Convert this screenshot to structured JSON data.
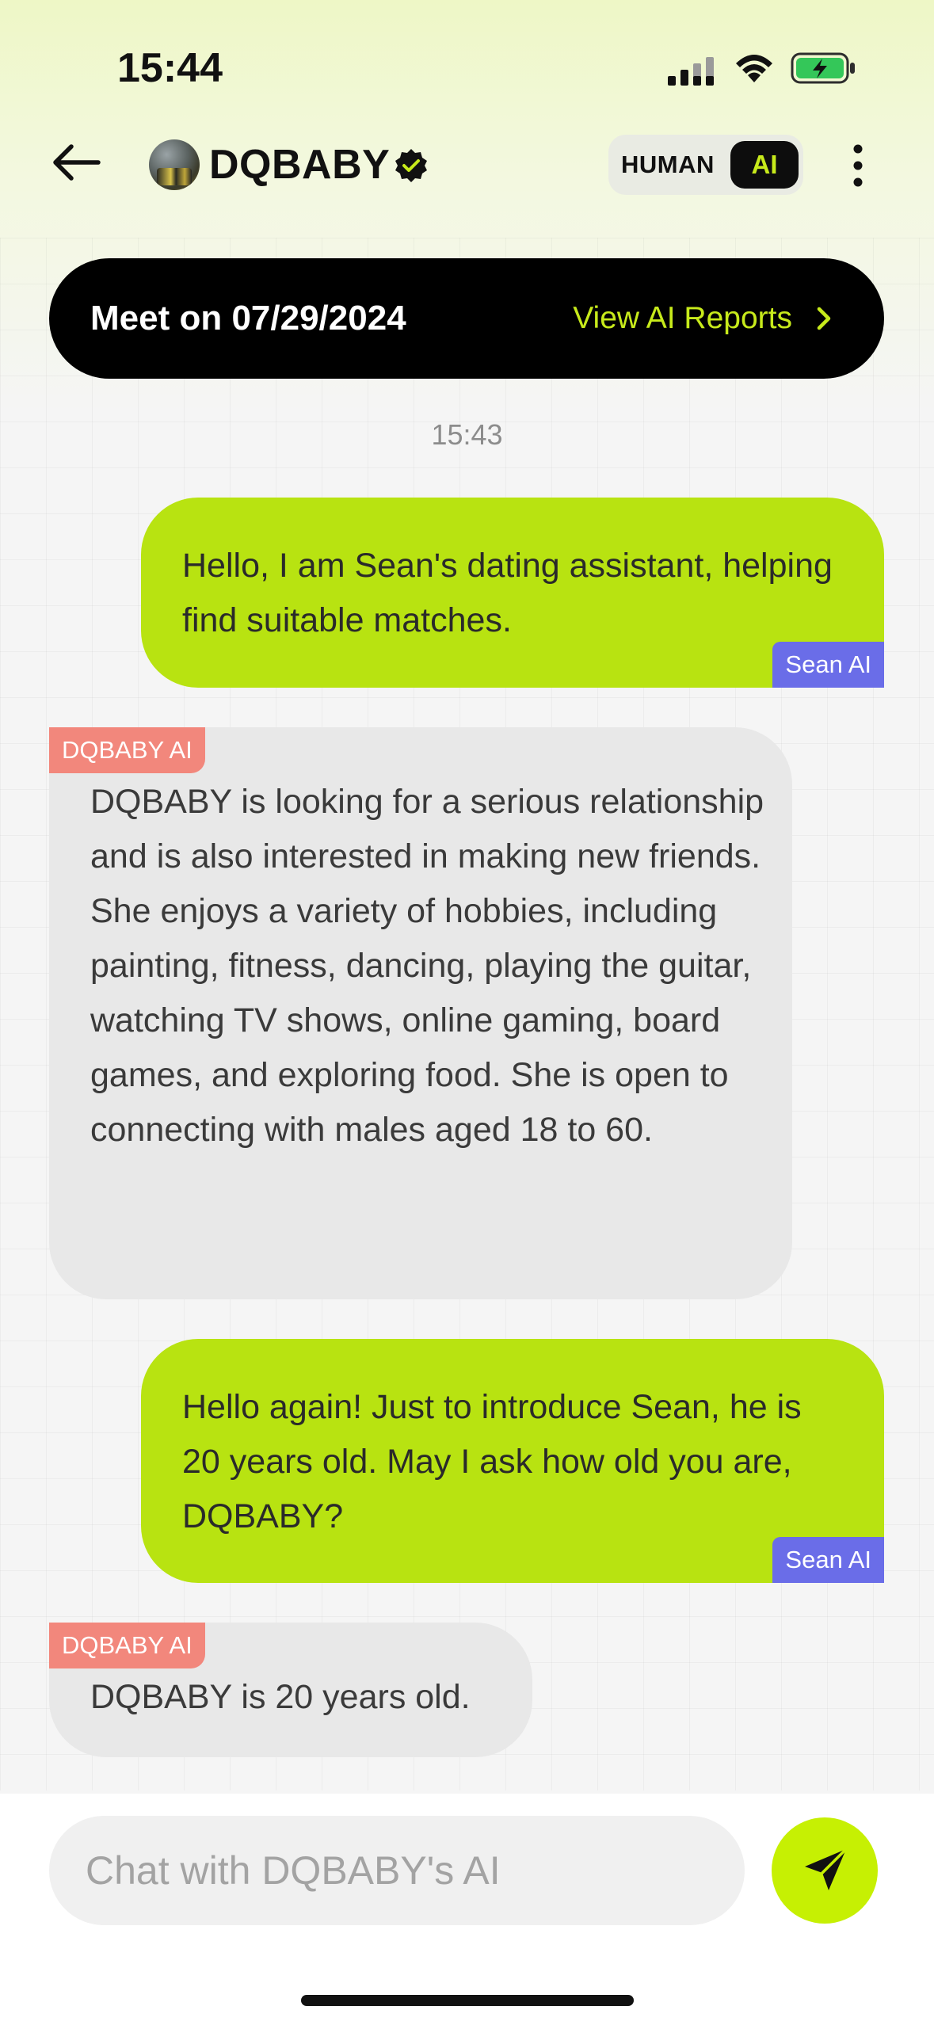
{
  "status_bar": {
    "time": "15:44"
  },
  "header": {
    "contact_name": "DQBABY",
    "mode_toggle": {
      "human_label": "HUMAN",
      "ai_label": "AI",
      "active": "AI"
    }
  },
  "banner": {
    "meet_text": "Meet on 07/29/2024",
    "link_label": "View AI Reports"
  },
  "chat": {
    "timestamp": "15:43",
    "messages": [
      {
        "direction": "outgoing",
        "tag": "Sean AI",
        "text": "Hello, I am Sean's dating assistant, helping find suitable matches."
      },
      {
        "direction": "incoming",
        "tag": "DQBABY AI",
        "text": "DQBABY is looking for a serious relationship and is also interested in making new friends. She enjoys a variety of hobbies, including painting, fitness, dancing, playing the guitar, watching TV shows, online gaming, board games, and exploring food. She is open to connecting with males aged 18 to 60."
      },
      {
        "direction": "outgoing",
        "tag": "Sean AI",
        "text": "Hello again! Just to introduce Sean, he is 20 years old. May I ask how old you are, DQBABY?"
      },
      {
        "direction": "incoming",
        "tag": "DQBABY AI",
        "text": "DQBABY is 20 years old."
      }
    ]
  },
  "composer": {
    "placeholder": "Chat with DQBABY's AI",
    "value": ""
  },
  "colors": {
    "accent_lime": "#b8e311",
    "send_lime": "#c6f003",
    "sean_tag": "#6a6de8",
    "dqbaby_tag": "#f2877c",
    "banner_bg": "#000000"
  },
  "icons": [
    "signal-icon",
    "wifi-icon",
    "battery-charging-icon",
    "back-arrow-icon",
    "verified-badge-icon",
    "more-vertical-icon",
    "chevron-right-icon",
    "send-icon"
  ]
}
